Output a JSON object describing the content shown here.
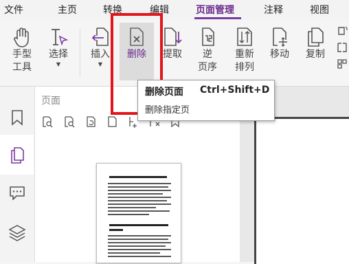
{
  "menubar": {
    "items": [
      "文件",
      "主页",
      "转换",
      "编辑",
      "页面管理",
      "注释",
      "视图"
    ],
    "active": "页面管理"
  },
  "ribbon": {
    "hand_line1": "手型",
    "hand_line2": "工具",
    "select": "选择",
    "insert": "插入",
    "delete": "删除",
    "extract": "提取",
    "reverse_line1": "逆",
    "reverse_line2": "页序",
    "rearrange_line1": "重新",
    "rearrange_line2": "排列",
    "move": "移动",
    "copy": "复制"
  },
  "tooltip": {
    "title": "删除页面",
    "shortcut": "Ctrl+Shift+D",
    "description": "删除指定页"
  },
  "panel": {
    "title": "页面"
  },
  "colors": {
    "accent": "#7a3aa0",
    "highlight_box": "#e2141c"
  }
}
